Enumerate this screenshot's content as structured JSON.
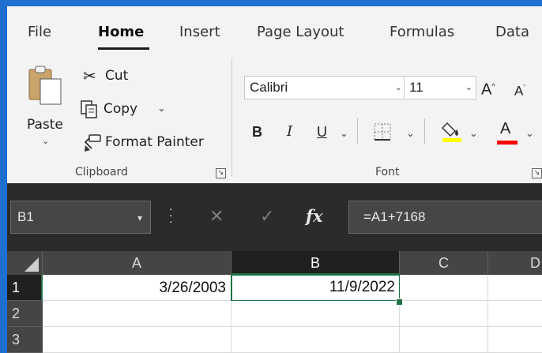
{
  "tabs": [
    "File",
    "Home",
    "Insert",
    "Page Layout",
    "Formulas",
    "Data"
  ],
  "clipboard": {
    "paste_label": "Paste",
    "cut_label": "Cut",
    "copy_label": "Copy",
    "format_painter_label": "Format Painter",
    "group_label": "Clipboard"
  },
  "font": {
    "font_name": "Calibri",
    "font_size": "11",
    "bold_label": "B",
    "italic_label": "I",
    "underline_label": "U",
    "grow_label": "A",
    "shrink_label": "A",
    "group_label": "Font",
    "highlight_color": "#ffff00",
    "font_color": "#ff0000"
  },
  "formula_bar": {
    "name_box": "B1",
    "fx_label": "fx",
    "formula": "=A1+7168"
  },
  "sheet": {
    "columns": [
      "A",
      "B",
      "C",
      "D"
    ],
    "rows": [
      "1",
      "2",
      "3"
    ],
    "cells": {
      "A1": "3/26/2003",
      "B1": "11/9/2022"
    },
    "selected_cell": "B1",
    "accent_color": "#1e7145"
  }
}
